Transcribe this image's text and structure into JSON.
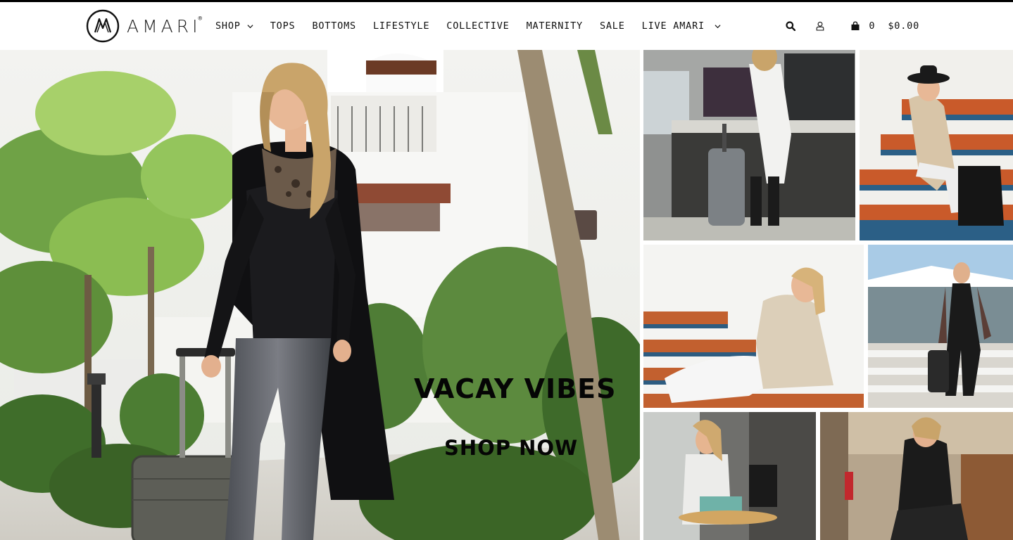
{
  "brand": {
    "name": "AMARI",
    "reg": "®"
  },
  "nav": {
    "items": [
      {
        "label": "SHOP",
        "has_dropdown": true
      },
      {
        "label": "TOPS"
      },
      {
        "label": "BOTTOMS"
      },
      {
        "label": "LIFESTYLE"
      },
      {
        "label": "COLLECTIVE"
      },
      {
        "label": "MATERNITY"
      },
      {
        "label": "SALE"
      },
      {
        "label": "LIVE AMARI",
        "has_dropdown": true
      }
    ]
  },
  "tools": {
    "search_icon": "search-icon",
    "account_icon": "user-icon",
    "cart_icon": "shopping-bag-icon",
    "cart_count": "0",
    "cart_total": "$0.00"
  },
  "hero": {
    "title": "VACAY VIBES",
    "cta": "SHOP NOW"
  },
  "colors": {
    "text": "#111111",
    "background": "#ffffff"
  }
}
